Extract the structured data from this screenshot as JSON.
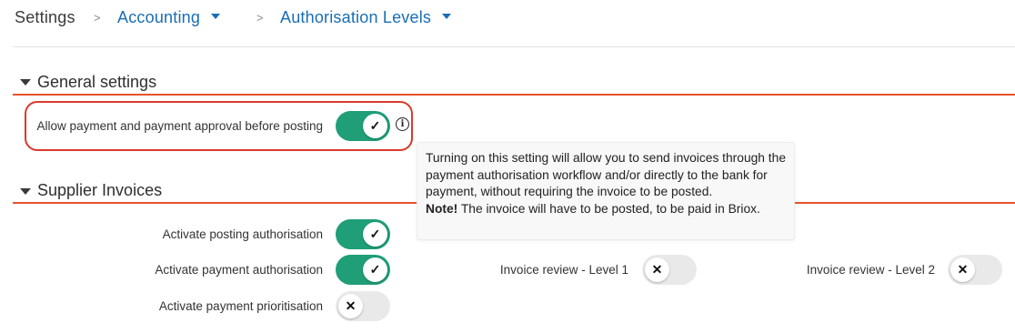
{
  "breadcrumb": {
    "root": "Settings",
    "separator": ">",
    "accounting": "Accounting",
    "authorisation_levels": "Authorisation Levels"
  },
  "general_settings": {
    "title": "General settings",
    "allow_payment": {
      "label": "Allow payment and payment approval before posting",
      "enabled": true
    }
  },
  "tooltip": {
    "text": "Turning on this setting will allow you to send invoices through the payment authorisation workflow and/or directly to the bank for payment, without requiring the invoice to be posted.",
    "note_label": "Note!",
    "note_text": " The invoice will have to be posted, to be paid in Briox."
  },
  "supplier_invoices": {
    "title": "Supplier Invoices",
    "posting_authorisation": {
      "label": "Activate posting authorisation",
      "enabled": true
    },
    "payment_authorisation": {
      "label": "Activate payment authorisation",
      "enabled": true
    },
    "payment_prioritisation": {
      "label": "Activate payment prioritisation",
      "enabled": false
    },
    "review_level_1": {
      "label": "Invoice review - Level 1",
      "enabled": false
    },
    "review_level_2": {
      "label": "Invoice review - Level 2",
      "enabled": false
    }
  },
  "icons": {
    "check": "✓",
    "cross": "✕",
    "info": "i"
  },
  "colors": {
    "accent_blue": "#1a6db5",
    "toggle_on": "#1f9e78",
    "toggle_off": "#e9e9e9",
    "section_line": "#e8532a",
    "highlight_red": "#d93a2b"
  }
}
